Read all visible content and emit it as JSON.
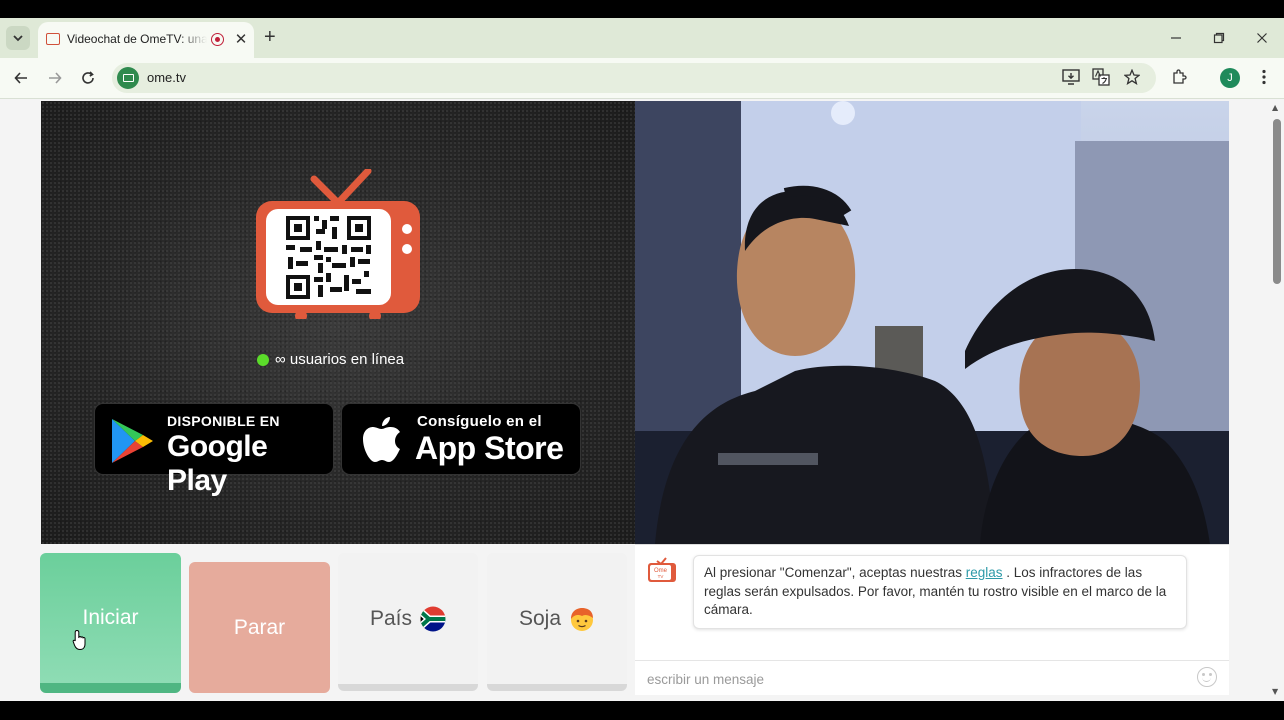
{
  "browser": {
    "tab_title": "Videochat de OmeTV: una alternativa",
    "tab_close_glyph": "✕",
    "new_tab_glyph": "+",
    "url": "ome.tv",
    "profile_initial": "J",
    "icons": [
      "chevron-down-icon",
      "favicon-icon",
      "record-icon",
      "close-icon",
      "plus-icon",
      "minimize-icon",
      "restore-icon",
      "window-close-icon",
      "back-arrow-icon",
      "forward-arrow-icon",
      "reload-icon",
      "site-info-icon",
      "install-app-icon",
      "translate-icon",
      "bookmark-star-icon",
      "extensions-icon",
      "kebab-menu-icon"
    ]
  },
  "left_panel": {
    "online_text": "∞ usuarios en línea",
    "online_color": "#5bdc2a",
    "google_play": {
      "small": "DISPONIBLE EN",
      "big": "Google Play"
    },
    "app_store": {
      "small": "Consíguelo en el",
      "big": "App Store"
    },
    "logo_color": "#e05a3c"
  },
  "chat": {
    "message_before_link": "Al presionar \"Comenzar\", aceptas nuestras ",
    "message_link": "reglas",
    "message_after_link": " . Los infractores de las reglas serán expulsados. Por favor, mantén tu rostro visible en el marco de la cámara.",
    "logo_text_top": "Ome",
    "logo_text_bottom": "TV",
    "input_placeholder": "escribir un mensaje"
  },
  "controls": {
    "start_label": "Iniciar",
    "stop_label": "Parar",
    "country_label": "País",
    "gender_label": "Soja",
    "start_color": "#6bcf9b",
    "stop_color": "#e6ab9c"
  }
}
